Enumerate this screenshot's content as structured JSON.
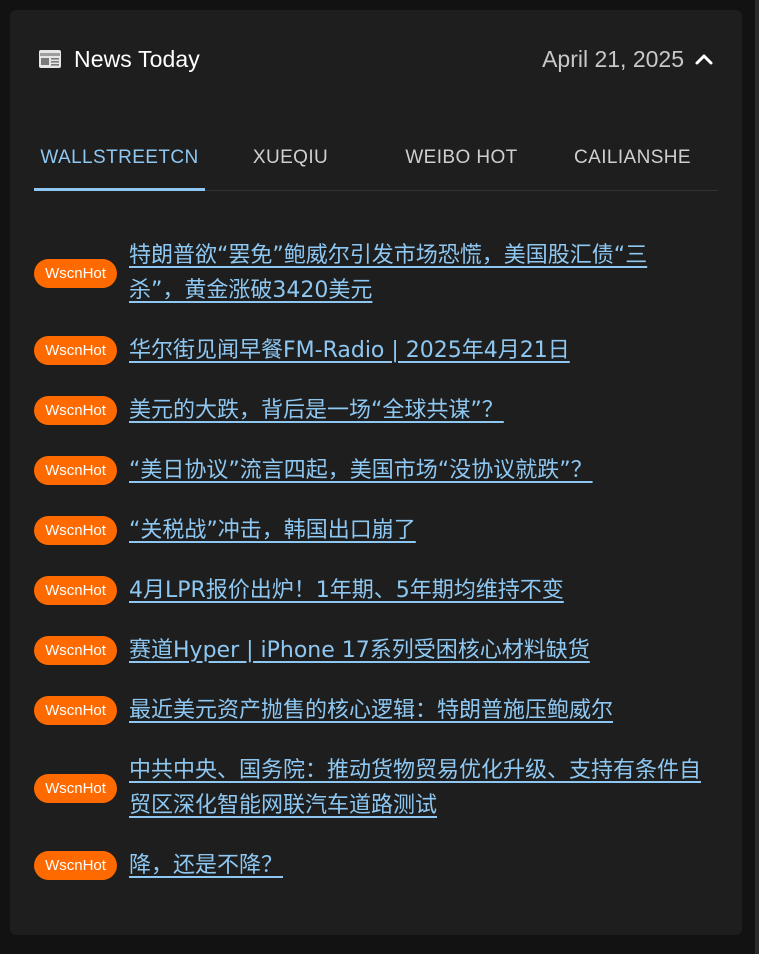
{
  "header": {
    "icon": "newspaper-icon",
    "title": "News Today",
    "date": "April 21, 2025",
    "toggle_icon": "chevron-up-icon"
  },
  "tabs": [
    {
      "label": "WALLSTREETCN",
      "active": true
    },
    {
      "label": "XUEQIU",
      "active": false
    },
    {
      "label": "WEIBO HOT",
      "active": false
    },
    {
      "label": "CAILIANSHE",
      "active": false
    }
  ],
  "colors": {
    "accent": "#8ec8f2",
    "badge": "#ff6a00",
    "card_bg": "#1e1e1e"
  },
  "news": [
    {
      "badge": "WscnHot",
      "title": "特朗普欲“罢免”鲍威尔引发市场恐慌，美国股汇债“三杀”，黄金涨破3420美元"
    },
    {
      "badge": "WscnHot",
      "title": "华尔街见闻早餐FM-Radio | 2025年4月21日"
    },
    {
      "badge": "WscnHot",
      "title": "美元的大跌，背后是一场“全球共谋”？"
    },
    {
      "badge": "WscnHot",
      "title": "“美日协议”流言四起，美国市场“没协议就跌”？"
    },
    {
      "badge": "WscnHot",
      "title": "“关税战”冲击，韩国出口崩了"
    },
    {
      "badge": "WscnHot",
      "title": "4月LPR报价出炉！1年期、5年期均维持不变"
    },
    {
      "badge": "WscnHot",
      "title": "赛道Hyper | iPhone 17系列受困核心材料缺货"
    },
    {
      "badge": "WscnHot",
      "title": "最近美元资产抛售的核心逻辑：特朗普施压鲍威尔"
    },
    {
      "badge": "WscnHot",
      "title": "中共中央、国务院：推动货物贸易优化升级、支持有条件自贸区深化智能网联汽车道路测试"
    },
    {
      "badge": "WscnHot",
      "title": "降，还是不降？"
    }
  ]
}
